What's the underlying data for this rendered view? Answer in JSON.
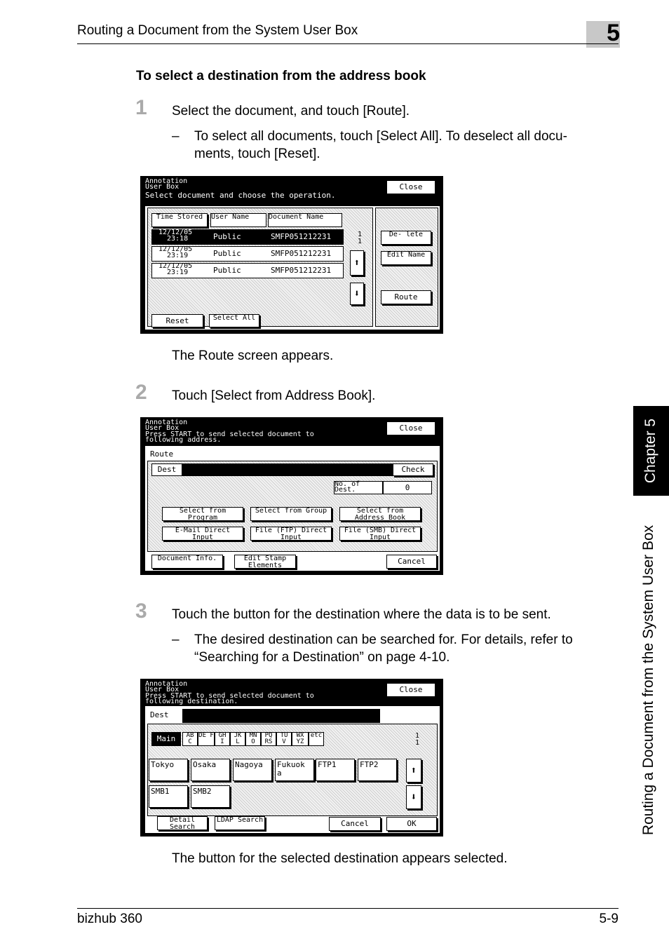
{
  "header": {
    "title": "Routing a Document from the System User Box",
    "chapter_number": "5"
  },
  "section_title": "To select a destination from the address book",
  "steps": [
    {
      "num": "1",
      "text": "Select the document, and touch [Route].",
      "sub": "To select all documents, touch [Select All]. To deselect all docu-",
      "sub2": "ments, touch [Reset].",
      "after": "The Route screen appears."
    },
    {
      "num": "2",
      "text": "Touch [Select from Address Book]."
    },
    {
      "num": "3",
      "text": "Touch the button for the destination where the data is to be sent.",
      "sub": "The desired destination can be searched for. For details, refer to",
      "sub2": "“Searching for a Destination” on page 4-10.",
      "after": "The button for the selected destination appears selected."
    }
  ],
  "dash": "–",
  "screen1": {
    "title1": "Annotation",
    "title2": "User Box",
    "instruction": "Select document and choose the operation.",
    "close": "Close",
    "col_time": "Time Stored",
    "col_user": "User Name",
    "col_doc": "Document Name",
    "rows": [
      {
        "date": "12/12/05",
        "time": "23:18",
        "user": "Public",
        "doc": "SMFP051212231"
      },
      {
        "date": "12/12/05",
        "time": "23:19",
        "user": "Public",
        "doc": "SMFP051212231"
      },
      {
        "date": "12/12/05",
        "time": "23:19",
        "user": "Public",
        "doc": "SMFP051212231"
      }
    ],
    "page": "1",
    "pages": "1",
    "delete": "De- lete",
    "edit_name": "Edit Name",
    "route": "Route",
    "reset": "Reset",
    "select_all": "Select All"
  },
  "screen2": {
    "title1": "Annotation",
    "title2": "User Box",
    "instr1": "Press START to send selected document to",
    "instr2": "following address.",
    "close": "Close",
    "route": "Route",
    "dest": "Dest",
    "check": "Check",
    "num_dest_label": "No. of Dest.",
    "num_dest": "0",
    "b1": "Select from Program",
    "b2": "Select from Group",
    "b3": "Select from Address Book",
    "b4": "E-Mail Direct Input",
    "b5": "File (FTP) Direct Input",
    "b6": "File (SMB) Direct Input",
    "doc_info": "Document Info.",
    "edit_stamp": "Edit Stamp Elements",
    "cancel": "Cancel"
  },
  "screen3": {
    "title1": "Annotation",
    "title2": "User Box",
    "instr1": "Press START to send selected document to",
    "instr2": "following destination.",
    "close": "Close",
    "dest": "Dest",
    "tabs": [
      "Main",
      "AB C",
      "DE F",
      "GH I",
      "JK L",
      "MN O",
      "PQ RS",
      "TU V",
      "WX YZ",
      "etc"
    ],
    "page": "1",
    "pages": "1",
    "dests": [
      "Tokyo",
      "Osaka",
      "Nagoya",
      "Fukuok a",
      "FTP1",
      "FTP2",
      "SMB1",
      "SMB2"
    ],
    "detail": "Detail Search",
    "ldap": "LDAP Search",
    "cancel": "Cancel",
    "ok": "OK"
  },
  "side": {
    "chapter": "Chapter 5",
    "title": "Routing a Document from the System User Box"
  },
  "footer": {
    "product": "bizhub 360",
    "page": "5-9"
  }
}
